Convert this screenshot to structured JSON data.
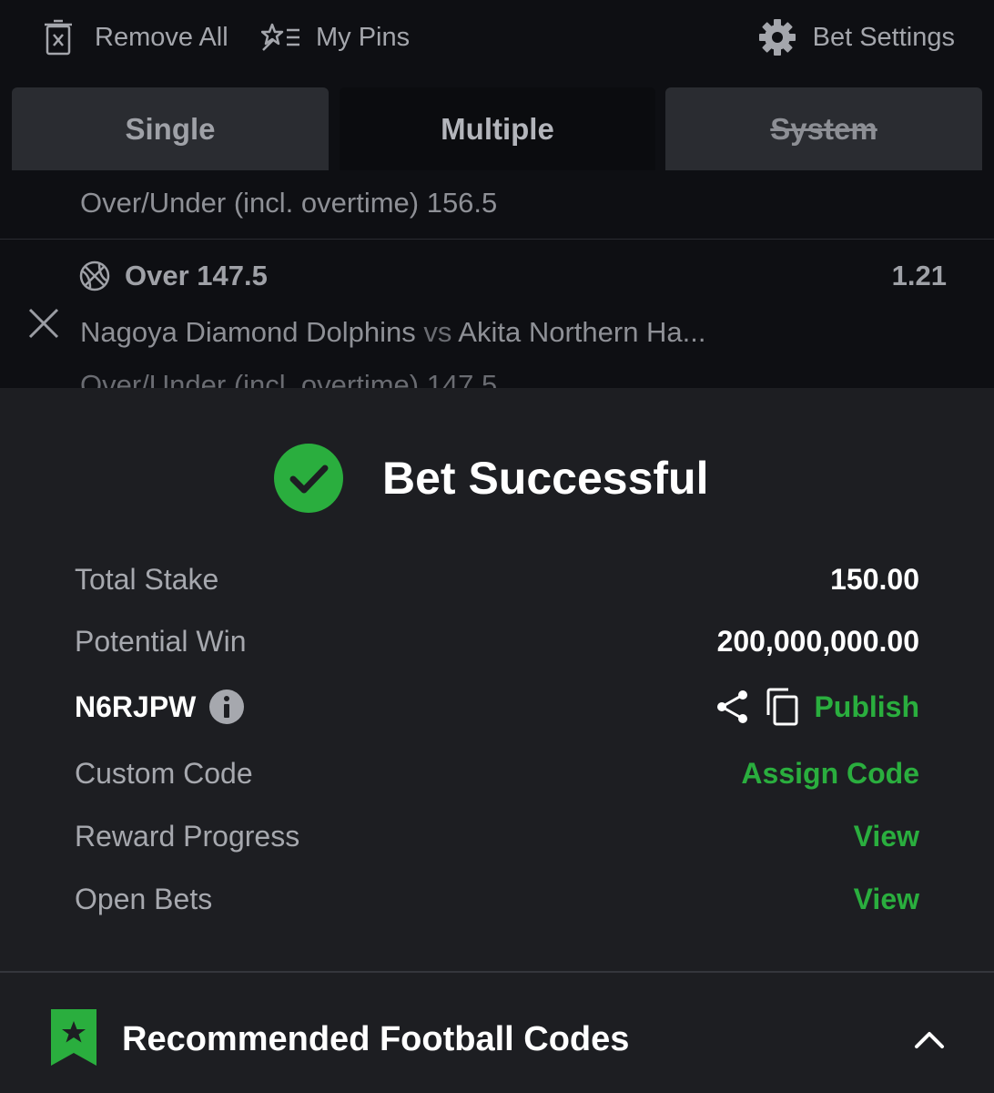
{
  "toolbar": {
    "remove_all": "Remove All",
    "my_pins": "My Pins",
    "bet_settings": "Bet Settings"
  },
  "tabs": [
    {
      "label": "Single",
      "state": "inactive"
    },
    {
      "label": "Multiple",
      "state": "active"
    },
    {
      "label": "System",
      "state": "disabled"
    }
  ],
  "bets": {
    "previous_market": "Over/Under (incl. overtime) 156.5",
    "current": {
      "selection": "Over 147.5",
      "odds": "1.21",
      "home_team": "Nagoya Diamond Dolphins",
      "vs": "vs",
      "away_team": "Akita Northern Ha...",
      "market": "Over/Under (incl. overtime) 147.5",
      "sport_icon": "basketball-icon"
    }
  },
  "confirmation": {
    "title": "Bet Successful",
    "total_stake_label": "Total Stake",
    "total_stake_value": "150.00",
    "potential_win_label": "Potential Win",
    "potential_win_value": "200,000,000.00",
    "booking_code": "N6RJPW",
    "publish_label": "Publish",
    "custom_code_label": "Custom Code",
    "assign_code_label": "Assign Code",
    "reward_progress_label": "Reward Progress",
    "reward_view_label": "View",
    "open_bets_label": "Open Bets",
    "open_bets_view_label": "View"
  },
  "recommended": {
    "title": "Recommended Football Codes"
  },
  "colors": {
    "accent_green": "#2aae3e",
    "panel_bg": "#1d1e22",
    "page_bg": "#0e0f13"
  }
}
